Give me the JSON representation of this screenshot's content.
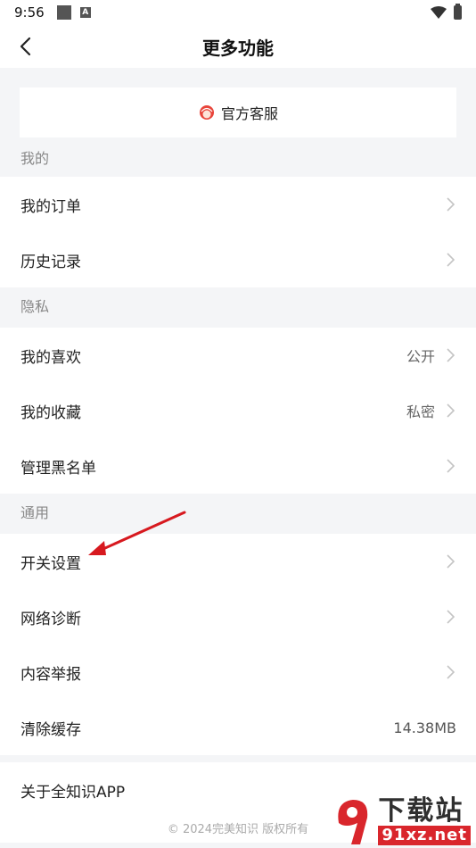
{
  "status_bar": {
    "time": "9:56",
    "a_badge": "A"
  },
  "header": {
    "title": "更多功能"
  },
  "customer_service": {
    "label": "官方客服"
  },
  "sections": {
    "mine": {
      "title": "我的",
      "items": [
        {
          "label": "我的订单"
        },
        {
          "label": "历史记录"
        }
      ]
    },
    "privacy": {
      "title": "隐私",
      "items": [
        {
          "label": "我的喜欢",
          "value": "公开"
        },
        {
          "label": "我的收藏",
          "value": "私密"
        },
        {
          "label": "管理黑名单"
        }
      ]
    },
    "general": {
      "title": "通用",
      "items": [
        {
          "label": "开关设置"
        },
        {
          "label": "网络诊断"
        },
        {
          "label": "内容举报"
        },
        {
          "label": "清除缓存",
          "value": "14.38MB"
        }
      ]
    }
  },
  "about": {
    "label": "关于全知识APP"
  },
  "footer": {
    "copyright": "© 2024完美知识 版权所有"
  },
  "watermark": {
    "brand": "下载站",
    "url": "91xz.net"
  },
  "colors": {
    "accent_red": "#d9262c",
    "annotation_arrow": "#d7191f"
  }
}
